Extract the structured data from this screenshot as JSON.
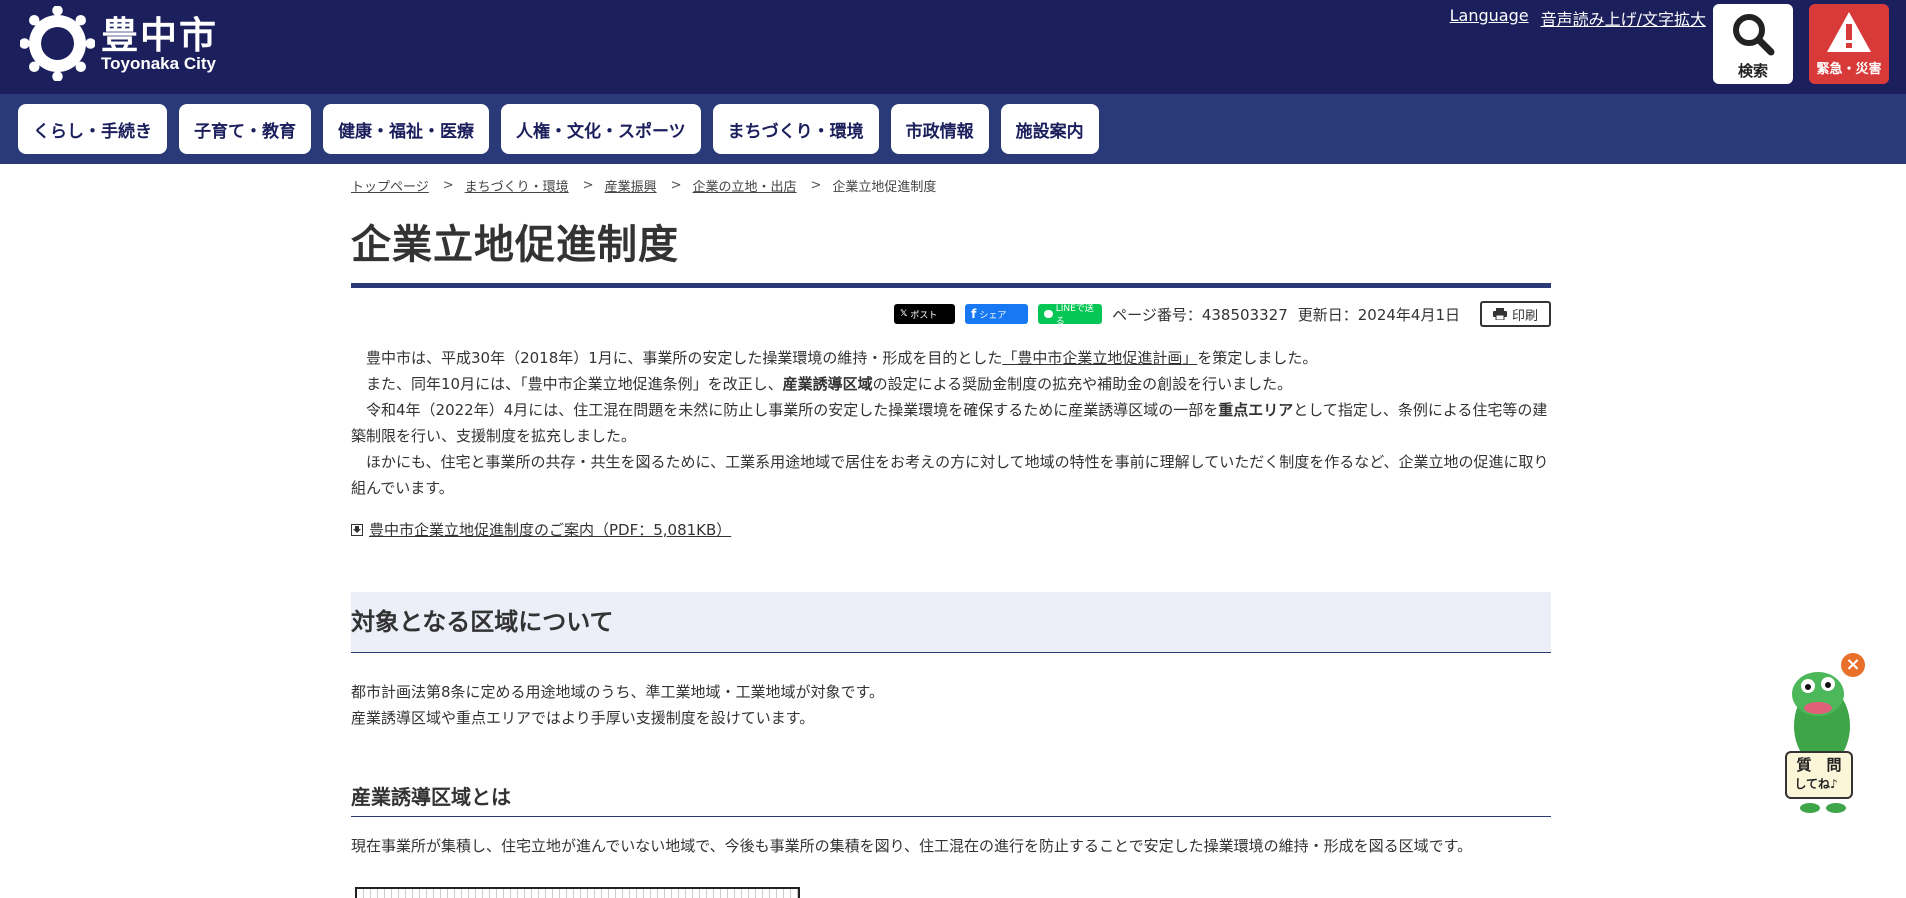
{
  "header": {
    "logo_jp": "豊中市",
    "logo_en": "Toyonaka City",
    "links": [
      "Language",
      "音声読み上げ/文字拡大"
    ],
    "search_label": "検索",
    "alert_label": "緊急・災害",
    "bg_color": "#1b1f5c"
  },
  "nav": {
    "items": [
      "くらし・手続き",
      "子育て・教育",
      "健康・福祉・医療",
      "人権・文化・スポーツ",
      "まちづくり・環境",
      "市政情報",
      "施設案内"
    ]
  },
  "breadcrumb": {
    "items": [
      "トップページ",
      "まちづくり・環境",
      "産業振興",
      "企業の立地・出店"
    ],
    "current": "企業立地促進制度"
  },
  "page": {
    "title": "企業立地促進制度",
    "share": {
      "x": "ポスト",
      "facebook": "シェア",
      "line": "LINEで送る"
    },
    "page_number": "ページ番号：438503327",
    "updated": "更新日：2024年4月1日",
    "print_label": "印刷"
  },
  "intro": {
    "p1_a": "豊中市は、平成30年（2018年）1月に、事業所の安定した操業環境の維持・形成を目的とした",
    "p1_link": "「豊中市企業立地促進計画」",
    "p1_b": "を策定しました。",
    "p2_a": "また、同年10月には、「豊中市企業立地促進条例」を改正し、",
    "p2_bold": "産業誘導区域",
    "p2_b": "の設定による奨励金制度の拡充や補助金の創設を行いました。",
    "p3_a": "令和4年（2022年）4月には、住工混在問題を未然に防止し事業所の安定した操業環境を確保するために産業誘導区域の一部を",
    "p3_bold": "重点エリア",
    "p3_b": "として指定し、条例による住宅等の建築制限を行い、支援制度を拡充しました。",
    "p4": "ほかにも、住宅と事業所の共存・共生を図るために、工業系用途地域で居住をお考えの方に対して地域の特性を事前に理解していただく制度を作るなど、企業立地の促進に取り組んでいます。",
    "pdf_link": "豊中市企業立地促進制度のご案内（PDF：5,081KB）"
  },
  "section1": {
    "title": "対象となる区域について",
    "line1": "都市計画法第8条に定める用途地域のうち、準工業地域・工業地域が対象です。",
    "line2": "産業誘導区域や重点エリアではより手厚い支援制度を設けています。"
  },
  "section2": {
    "title": "産業誘導区域とは",
    "body": "現在事業所が集積し、住宅立地が進んでいない地域で、今後も事業所の集積を図り、住工混在の進行を防止することで安定した操業環境の維持・形成を図る区域です。"
  },
  "mascot": {
    "label": "質　問\nしてね♪",
    "close": "×"
  }
}
